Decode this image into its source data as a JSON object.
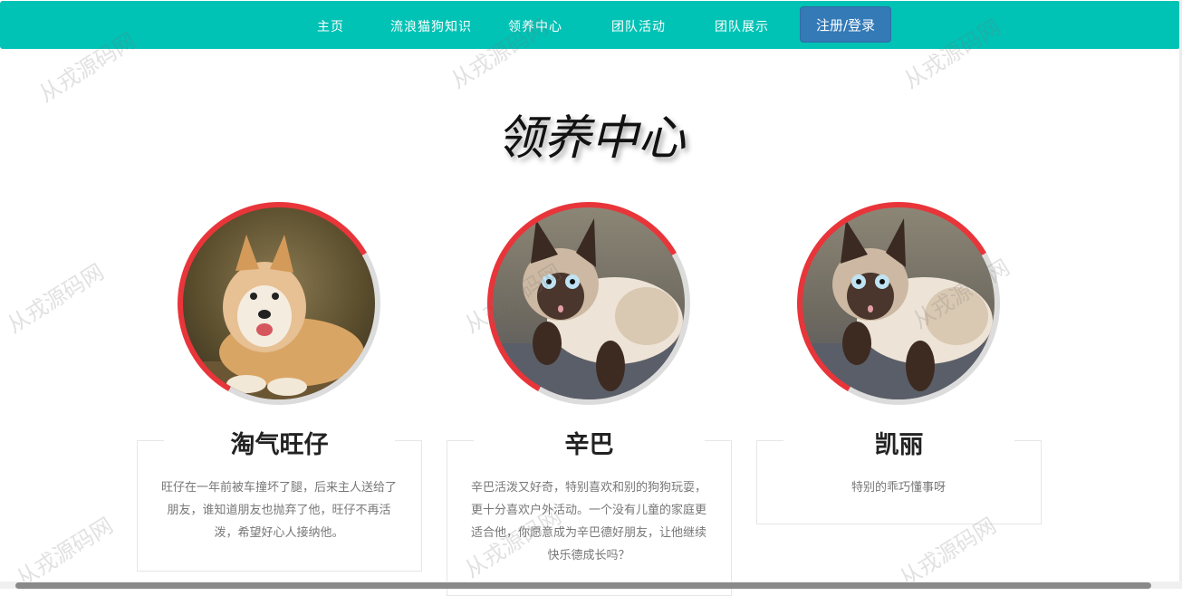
{
  "nav": {
    "items": [
      "主页",
      "流浪猫狗知识",
      "领养中心",
      "团队活动",
      "团队展示"
    ],
    "login_label": "注册/登录"
  },
  "page_title": "领养中心",
  "pets": [
    {
      "name": "淘气旺仔",
      "desc": "旺仔在一年前被车撞坏了腿，后来主人送给了朋友，谁知道朋友也抛弃了他，旺仔不再活泼，希望好心人接纳他。",
      "photo": "dog-photo"
    },
    {
      "name": "辛巴",
      "desc": "辛巴活泼又好奇，特别喜欢和别的狗狗玩耍，更十分喜欢户外活动。一个没有儿童的家庭更适合他，你愿意成为辛巴德好朋友，让他继续快乐德成长吗？",
      "photo": "cat-photo"
    },
    {
      "name": "凯丽",
      "desc": "特别的乖巧懂事呀",
      "photo": "cat-photo"
    }
  ],
  "watermark_text": "从戎源码网",
  "colors": {
    "nav_bg": "#00c2b5",
    "login_bg": "#337ab7",
    "ring_accent": "#e8353a"
  }
}
